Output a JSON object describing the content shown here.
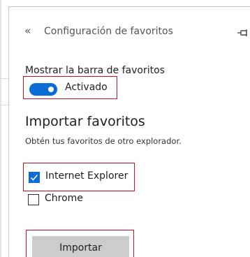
{
  "panel": {
    "back_icon": "«",
    "title": "Configuración de favoritos",
    "pin_icon": "pin-icon"
  },
  "favorites_bar": {
    "label": "Mostrar la barra de favoritos",
    "toggle_state": "Activado",
    "toggle_on": true
  },
  "import": {
    "title": "Importar favoritos",
    "description": "Obtén tus favoritos de otro explorador.",
    "browsers": [
      {
        "label": "Internet Explorer",
        "checked": true
      },
      {
        "label": "Chrome",
        "checked": false
      }
    ],
    "button_label": "Importar"
  },
  "colors": {
    "accent": "#0a6cd6",
    "highlight_border": "#d0101b",
    "button_bg": "#cccccc"
  }
}
